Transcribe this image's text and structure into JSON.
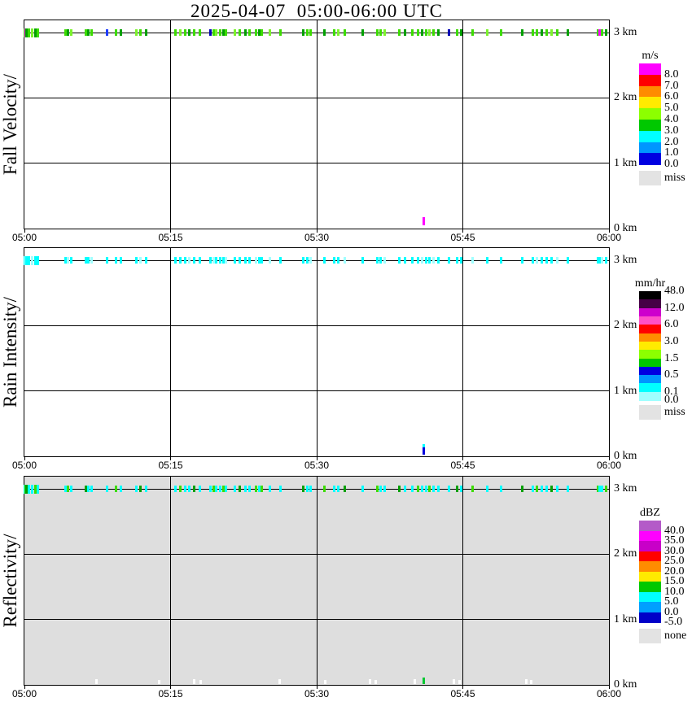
{
  "title": "2025-04-07  05:00-06:00 UTC",
  "chart_data": {
    "type": "heatmap",
    "title": "2025-04-07 05:00-06:00 UTC",
    "x_axis": {
      "unit": "UTC",
      "start": "05:00",
      "end": "06:00",
      "tick_labels": [
        "05:00",
        "05:15",
        "05:30",
        "05:45",
        "06:00"
      ]
    },
    "y_axis": {
      "unit": "km",
      "range_km": [
        0,
        3.2
      ],
      "tick_labels": [
        "3 km",
        "2 km",
        "1 km",
        "0 km"
      ]
    },
    "grid": "on",
    "echo_altitude_km": 3.0,
    "palette": {
      "g": "#3cdc00",
      "G": "#00a000",
      "e": "#7cf32c",
      "b": "#1e3cff",
      "n": "#0000b4",
      "m": "#ff00ff",
      "c": "#00ffff",
      "C": "#a0ffff",
      "B": "#0000dc",
      "R": "#00c832",
      "w": "#ffffff"
    },
    "events_note": "each event = [minutes after 05:00, fall-velocity color, rain-intensity color, reflectivity color] at 3.0 km",
    "events": [
      [
        0.0,
        "g",
        "c",
        "c"
      ],
      [
        0.12,
        "m",
        "C",
        "g"
      ],
      [
        0.25,
        "G",
        "c",
        "G"
      ],
      [
        0.5,
        "g",
        "c",
        "c"
      ],
      [
        0.8,
        "e",
        "C",
        "c"
      ],
      [
        1.1,
        "G",
        "c",
        "g"
      ],
      [
        1.4,
        "g",
        "c",
        "c"
      ],
      [
        4.2,
        "g",
        "c",
        "c"
      ],
      [
        4.5,
        "G",
        "C",
        "g"
      ],
      [
        4.8,
        "e",
        "c",
        "c"
      ],
      [
        6.3,
        "g",
        "c",
        "G"
      ],
      [
        6.6,
        "G",
        "c",
        "c"
      ],
      [
        6.9,
        "g",
        "C",
        "c"
      ],
      [
        8.5,
        "b",
        "c",
        "c"
      ],
      [
        9.4,
        "g",
        "c",
        "g"
      ],
      [
        9.9,
        "G",
        "c",
        "c"
      ],
      [
        11.5,
        "e",
        "c",
        "c"
      ],
      [
        11.9,
        "g",
        "C",
        "G"
      ],
      [
        12.5,
        "G",
        "c",
        "c"
      ],
      [
        15.5,
        "g",
        "c",
        "c"
      ],
      [
        16.0,
        "e",
        "c",
        "g"
      ],
      [
        16.5,
        "g",
        "c",
        "c"
      ],
      [
        16.9,
        "G",
        "C",
        "c"
      ],
      [
        17.4,
        "g",
        "c",
        "G"
      ],
      [
        18.0,
        "g",
        "c",
        "c"
      ],
      [
        19.1,
        "n",
        "c",
        "c"
      ],
      [
        19.4,
        "g",
        "C",
        "g"
      ],
      [
        19.7,
        "e",
        "c",
        "c"
      ],
      [
        20.1,
        "g",
        "c",
        "c"
      ],
      [
        20.4,
        "G",
        "c",
        "g"
      ],
      [
        20.7,
        "g",
        "C",
        "c"
      ],
      [
        21.6,
        "e",
        "c",
        "c"
      ],
      [
        22.1,
        "g",
        "c",
        "G"
      ],
      [
        22.7,
        "G",
        "c",
        "c"
      ],
      [
        23.1,
        "g",
        "c",
        "c"
      ],
      [
        23.8,
        "g",
        "C",
        "g"
      ],
      [
        24.1,
        "G",
        "c",
        "c"
      ],
      [
        24.4,
        "g",
        "c",
        "g"
      ],
      [
        25.2,
        "e",
        "C",
        "c"
      ],
      [
        26.3,
        "g",
        "c",
        "c"
      ],
      [
        28.6,
        "G",
        "c",
        "G"
      ],
      [
        29.0,
        "g",
        "c",
        "c"
      ],
      [
        29.4,
        "g",
        "C",
        "c"
      ],
      [
        30.8,
        "G",
        "c",
        "g"
      ],
      [
        31.8,
        "g",
        "c",
        "c"
      ],
      [
        32.2,
        "e",
        "c",
        "c"
      ],
      [
        32.9,
        "g",
        "C",
        "G"
      ],
      [
        34.7,
        "G",
        "c",
        "c"
      ],
      [
        36.2,
        "g",
        "c",
        "g"
      ],
      [
        36.6,
        "g",
        "c",
        "c"
      ],
      [
        37.0,
        "e",
        "C",
        "c"
      ],
      [
        38.5,
        "g",
        "c",
        "G"
      ],
      [
        39.1,
        "G",
        "c",
        "c"
      ],
      [
        39.8,
        "g",
        "c",
        "c"
      ],
      [
        40.4,
        "g",
        "c",
        "g"
      ],
      [
        40.8,
        "G",
        "C",
        "c"
      ],
      [
        41.2,
        "g",
        "c",
        "c"
      ],
      [
        41.6,
        "e",
        "c",
        "g"
      ],
      [
        42.0,
        "g",
        "C",
        "c"
      ],
      [
        42.5,
        "G",
        "c",
        "c"
      ],
      [
        43.6,
        "n",
        "c",
        "c"
      ],
      [
        44.4,
        "g",
        "c",
        "G"
      ],
      [
        44.8,
        "G",
        "c",
        "c"
      ],
      [
        46.0,
        "g",
        "C",
        "g"
      ],
      [
        47.5,
        "e",
        "c",
        "c"
      ],
      [
        48.9,
        "g",
        "c",
        "c"
      ],
      [
        51.1,
        "G",
        "c",
        "G"
      ],
      [
        52.2,
        "g",
        "c",
        "c"
      ],
      [
        52.6,
        "g",
        "C",
        "g"
      ],
      [
        53.1,
        "G",
        "c",
        "c"
      ],
      [
        53.6,
        "g",
        "c",
        "c"
      ],
      [
        54.1,
        "e",
        "c",
        "G"
      ],
      [
        54.7,
        "g",
        "C",
        "c"
      ],
      [
        55.8,
        "G",
        "c",
        "c"
      ],
      [
        58.9,
        "g",
        "c",
        "g"
      ],
      [
        59.0,
        "m",
        "c",
        "c"
      ],
      [
        59.3,
        "g",
        "C",
        "c"
      ],
      [
        59.7,
        "G",
        "c",
        "g"
      ]
    ],
    "bottom_marks_note": "near-surface marks: [minutes, color, height_px, offset_above_axis_px]",
    "bottom_marks": {
      "fall_velocity": [
        [
          41.0,
          "m",
          10,
          4
        ]
      ],
      "rain_intensity": [
        [
          41.0,
          "c",
          4,
          11
        ],
        [
          41.0,
          "B",
          9,
          2
        ]
      ],
      "reflectivity": [
        [
          41.0,
          "R",
          8,
          1
        ],
        [
          7.4,
          "w",
          6,
          1
        ],
        [
          13.8,
          "w",
          5,
          1
        ],
        [
          17.4,
          "w",
          6,
          1
        ],
        [
          18.1,
          "w",
          5,
          1
        ],
        [
          26.2,
          "w",
          6,
          1
        ],
        [
          30.9,
          "w",
          5,
          1
        ],
        [
          35.5,
          "w",
          6,
          1
        ],
        [
          36.1,
          "w",
          5,
          1
        ],
        [
          40.1,
          "w",
          6,
          1
        ],
        [
          44.1,
          "w",
          6,
          1
        ],
        [
          44.7,
          "w",
          5,
          1
        ],
        [
          51.5,
          "w",
          6,
          1
        ],
        [
          52.0,
          "w",
          5,
          1
        ]
      ]
    },
    "panels": [
      {
        "name": "Fall Velocity",
        "key": "fall_velocity",
        "ylabel_display": "Fall Velocity/",
        "background": "#ffffff",
        "colorbar": {
          "title": "m/s",
          "colors": [
            "#ff00ff",
            "#ff0000",
            "#ff8c00",
            "#ffeb00",
            "#8cff00",
            "#00c800",
            "#00ffff",
            "#0096ff",
            "#0000e1"
          ],
          "labels": [
            "8.0",
            "7.0",
            "6.0",
            "5.0",
            "4.0",
            "3.0",
            "2.0",
            "1.0",
            "0.0"
          ],
          "label_positions": [
            1,
            2,
            3,
            4,
            5,
            6,
            7,
            8,
            9
          ],
          "missing_label": "miss",
          "missing_color": "#e3e3e3"
        }
      },
      {
        "name": "Rain Intensity",
        "key": "rain_intensity",
        "ylabel_display": "Rain Intensity/",
        "background": "#ffffff",
        "colorbar": {
          "title": "mm/hr",
          "colors": [
            "#000000",
            "#460046",
            "#cd00cd",
            "#ff50c8",
            "#ff0000",
            "#ff8c00",
            "#ffeb00",
            "#8cff00",
            "#00c800",
            "#0000e1",
            "#0096ff",
            "#00ffff",
            "#a0ffff"
          ],
          "labels": [
            "48.0",
            "12.0",
            "6.0",
            "3.0",
            "1.5",
            "0.5",
            "0.1",
            "0.0"
          ],
          "label_positions": [
            0,
            2,
            4,
            6,
            8,
            10,
            12,
            13
          ],
          "missing_label": "miss",
          "missing_color": "#e3e3e3"
        }
      },
      {
        "name": "Reflectivity",
        "key": "reflectivity",
        "ylabel_display": "Reflectivity/",
        "background": "#dedede",
        "colorbar": {
          "title": "dBZ",
          "colors": [
            "#b45ac8",
            "#ff00ff",
            "#c800c8",
            "#ff0000",
            "#ff8c00",
            "#ffeb00",
            "#00c800",
            "#00ffff",
            "#00a0ff",
            "#0000c8"
          ],
          "labels": [
            "40.0",
            "35.0",
            "30.0",
            "25.0",
            "20.0",
            "15.0",
            "10.0",
            "5.0",
            "0.0",
            "-5.0"
          ],
          "label_positions": [
            1,
            2,
            3,
            4,
            5,
            6,
            7,
            8,
            9,
            10
          ],
          "missing_label": "none",
          "missing_color": "#e3e3e3"
        }
      }
    ]
  }
}
